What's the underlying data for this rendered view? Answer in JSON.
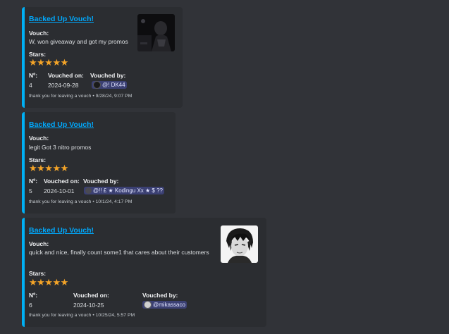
{
  "vouches": [
    {
      "title": "Backed Up Vouch!",
      "vouch_label": "Vouch:",
      "vouch_text": "W, won giveaway and got my promos",
      "stars_label": "Stars:",
      "stars": "★★★★★",
      "stars_rating": 5,
      "number_label": "Nº:",
      "number": "4",
      "vouched_on_label": "Vouched on:",
      "vouched_on": "2024-09-28",
      "vouched_by_label": "Vouched by:",
      "vouched_by": "@! DK44",
      "footer_text": "thank you for leaving a vouch",
      "footer_time": "9/28/24, 9:07 PM"
    },
    {
      "title": "Backed Up Vouch!",
      "vouch_label": "Vouch:",
      "vouch_text": "legit Got 3 nitro promos",
      "stars_label": "Stars:",
      "stars": "★★★★★",
      "stars_rating": 5,
      "number_label": "Nº:",
      "number": "5",
      "vouched_on_label": "Vouched on:",
      "vouched_on": "2024-10-01",
      "vouched_by_label": "Vouched by:",
      "vouched_by": "@!! £ ★ Kodingu Xx ★ $ ??",
      "footer_text": "thank you for leaving a vouch",
      "footer_time": "10/1/24, 4:17 PM"
    },
    {
      "title": "Backed Up Vouch!",
      "vouch_label": "Vouch:",
      "vouch_text": "quick and nice, finally count some1 that cares about their customers",
      "stars_label": "Stars:",
      "stars": "★★★★★",
      "stars_rating": 5,
      "number_label": "Nº:",
      "number": "6",
      "vouched_on_label": "Vouched on:",
      "vouched_on": "2024-10-25",
      "vouched_by_label": "Vouched by:",
      "vouched_by": "@mikassaco",
      "footer_text": "thank you for leaving a vouch",
      "footer_time": "10/25/24, 5:57 PM"
    }
  ],
  "footer_separator": "•",
  "colors": {
    "background": "#313338",
    "embed": "#2b2d31",
    "embed_border": "#00b0f4",
    "link": "#00a8fc",
    "star": "#f4a428",
    "mention_bg": "#3c4270"
  }
}
